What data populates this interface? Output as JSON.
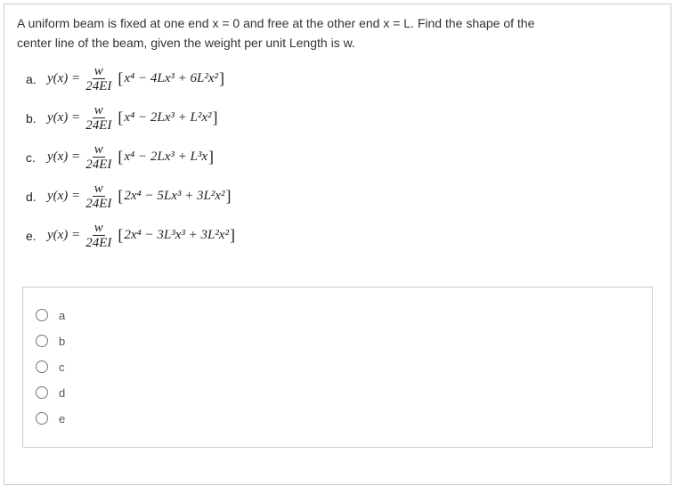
{
  "question": {
    "line1": "A uniform beam is fixed at one end  x = 0 and free at the other end x = L.  Find the shape of the",
    "line2": "center line of the beam, given the weight per unit Length is w."
  },
  "options": [
    {
      "label": "a.",
      "lhs": "y(x) =",
      "coef_num": "w",
      "coef_den": "24EI",
      "poly": "x⁴ − 4Lx³ + 6L²x²"
    },
    {
      "label": "b.",
      "lhs": "y(x) =",
      "coef_num": "w",
      "coef_den": "24EI",
      "poly": "x⁴ − 2Lx³ + L²x²"
    },
    {
      "label": "c.",
      "lhs": "y(x) =",
      "coef_num": "w",
      "coef_den": "24EI",
      "poly": "x⁴ − 2Lx³ + L³x"
    },
    {
      "label": "d.",
      "lhs": "y(x) =",
      "coef_num": "w",
      "coef_den": "24EI",
      "poly": "2x⁴ − 5Lx³ + 3L²x²"
    },
    {
      "label": "e.",
      "lhs": "y(x) =",
      "coef_num": "w",
      "coef_den": "24EI",
      "poly": "2x⁴ − 3L³x³ + 3L²x²"
    }
  ],
  "answers": [
    {
      "label": "a"
    },
    {
      "label": "b"
    },
    {
      "label": "c"
    },
    {
      "label": "d"
    },
    {
      "label": "e"
    }
  ]
}
